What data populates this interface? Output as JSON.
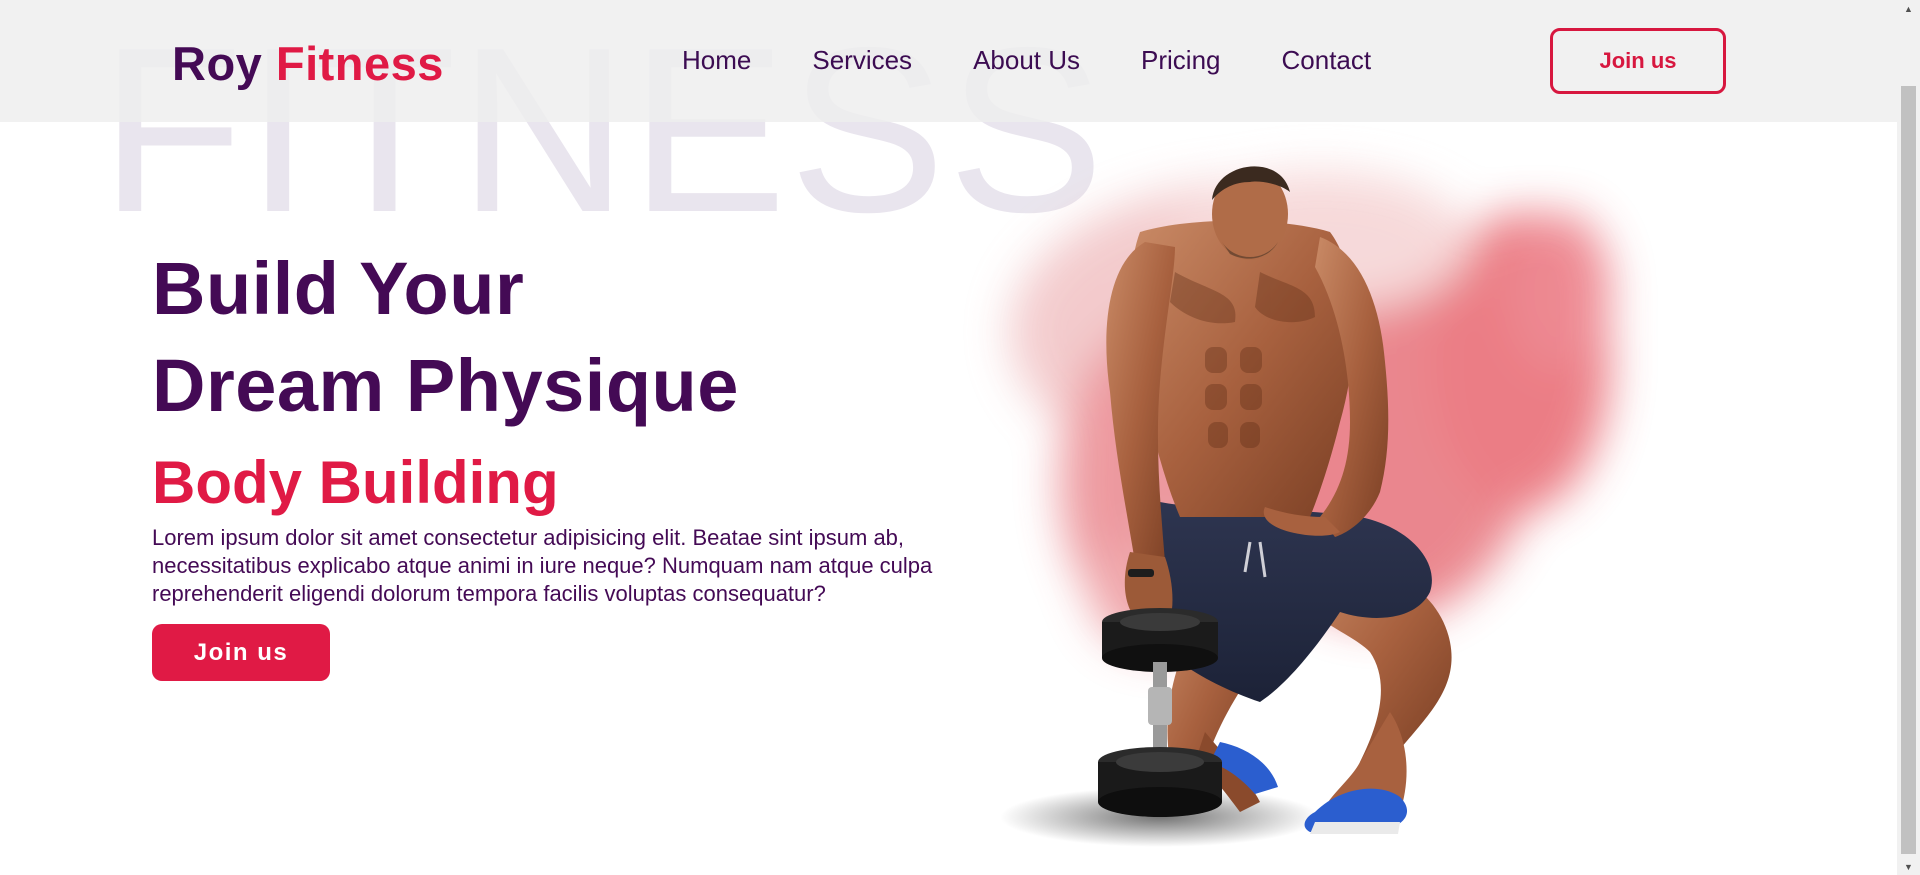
{
  "background_word": "FITNESS",
  "brand": {
    "name_part1": "Roy",
    "name_part2": "Fitness"
  },
  "nav": {
    "items": [
      {
        "label": "Home"
      },
      {
        "label": "Services"
      },
      {
        "label": "About Us"
      },
      {
        "label": "Pricing"
      },
      {
        "label": "Contact"
      }
    ],
    "cta_label": "Join us"
  },
  "hero": {
    "title_line1": "Build Your",
    "title_line2": "Dream Physique",
    "subtitle": "Body Building",
    "description": "Lorem ipsum dolor sit amet consectetur adipisicing elit. Beatae sint ipsum ab, necessitatibus explicabo atque animi in iure neque? Numquam nam atque culpa reprehenderit eligendi dolorum tempora facilis voluptas consequatur?",
    "cta_label": "Join us"
  },
  "colors": {
    "brand_dark": "#440a55",
    "brand_accent": "#e01a45",
    "header_bg": "#eeeeee",
    "watermark": "#e9e5ee"
  }
}
